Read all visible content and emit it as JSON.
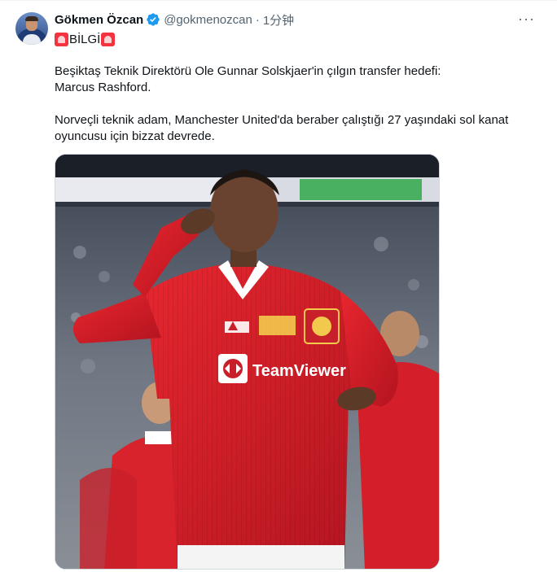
{
  "tweet": {
    "author_name": "Gökmen Özcan",
    "handle": "@gokmenozcan",
    "separator": "·",
    "time": "1分钟",
    "more_label": "···",
    "tag_text": "BİLGİ",
    "paragraph_1_line_1": "Beşiktaş Teknik Direktörü Ole Gunnar Solskjaer'in çılgın transfer hedefi:",
    "paragraph_1_line_2": "Marcus Rashford.",
    "paragraph_2_line_1": "Norveçli teknik adam, Manchester United'da beraber çalıştığı 27 yaşındaki sol kanat",
    "paragraph_2_line_2": "oyuncusu için bizzat devrede."
  },
  "media": {
    "description_icon": "photo",
    "sponsor_text": "TeamViewer",
    "kit_brand": "adidas"
  },
  "colors": {
    "verified": "#1d9bf0",
    "handle": "#536471",
    "kit_red": "#d81e2c",
    "siren": "#f4333f"
  }
}
